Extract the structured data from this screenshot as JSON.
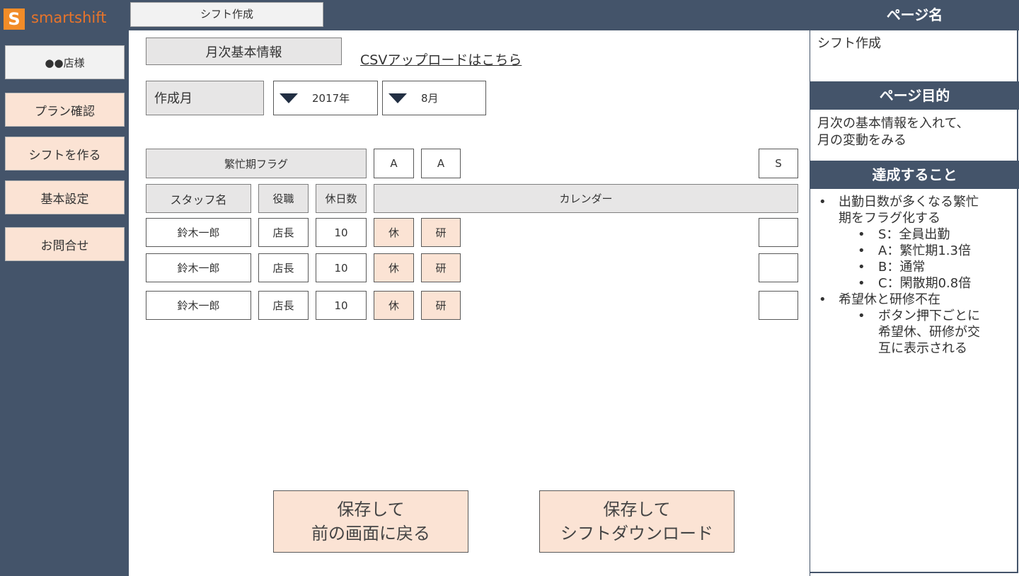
{
  "app": {
    "logo_letter": "S",
    "logo_name": "smartshift"
  },
  "header": {
    "tab_label": "シフト作成"
  },
  "sidebar": {
    "items": [
      {
        "label": "●●店様"
      },
      {
        "label": "プラン確認"
      },
      {
        "label": "シフトを作る"
      },
      {
        "label": "基本設定"
      },
      {
        "label": "お問合せ"
      }
    ]
  },
  "main": {
    "section_title": "月次基本情報",
    "csv_link": "CSVアップロードはこちら",
    "month_label": "作成月",
    "year_select": "2017年",
    "month_select": "8月",
    "busy_flag_label": "繁忙期フラグ",
    "flags": [
      "A",
      "A",
      "S"
    ],
    "columns": {
      "staff": "スタッフ名",
      "role": "役職",
      "days_off": "休日数",
      "calendar": "カレンダー"
    },
    "rows": [
      {
        "name": "鈴木一郎",
        "role": "店長",
        "days_off": "10",
        "c1": "休",
        "c2": "研"
      },
      {
        "name": "鈴木一郎",
        "role": "店長",
        "days_off": "10",
        "c1": "休",
        "c2": "研"
      },
      {
        "name": "鈴木一郎",
        "role": "店長",
        "days_off": "10",
        "c1": "休",
        "c2": "研"
      }
    ],
    "btn_back_line1": "保存して",
    "btn_back_line2": "前の画面に戻る",
    "btn_download_line1": "保存して",
    "btn_download_line2": "シフトダウンロード"
  },
  "panel": {
    "page_name_head": "ページ名",
    "page_name": "シフト作成",
    "purpose_head": "ページ目的",
    "purpose_line1": "月次の基本情報を入れて、",
    "purpose_line2": "月の変動をみる",
    "goals_head": "達成すること",
    "goal1_line1": "出勤日数が多くなる繁忙",
    "goal1_line2": "期をフラグ化する",
    "goal1_sub": [
      "S：全員出勤",
      "A：繁忙期1.3倍",
      "B：通常",
      "C：閑散期0.8倍"
    ],
    "goal2": "希望休と研修不在",
    "goal2_sub_line1": "ボタン押下ごとに",
    "goal2_sub_line2": "希望休、研修が交",
    "goal2_sub_line3": "互に表示される"
  },
  "colors": {
    "navy": "#44546a",
    "peach": "#fbe3d4",
    "gray": "#e7e6e6",
    "logo_orange": "#f28c28"
  }
}
